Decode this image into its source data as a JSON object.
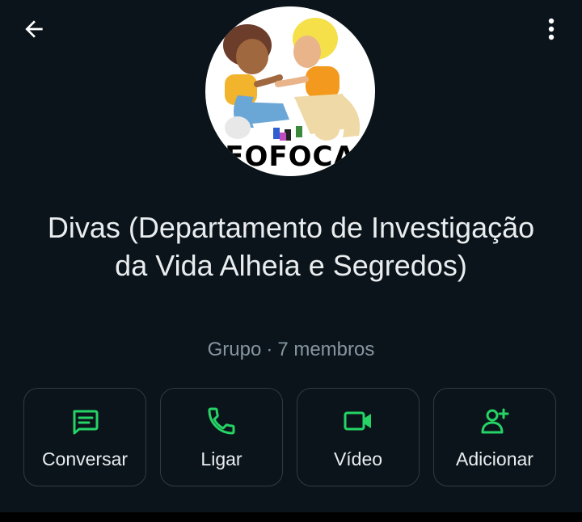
{
  "header": {
    "back_icon": "arrow-left-icon",
    "menu_icon": "more-vert-icon"
  },
  "avatar": {
    "caption": "EOFOCA"
  },
  "group": {
    "name": "Divas (Departamento de Investigação da Vida Alheia e Segredos)",
    "type": "Grupo",
    "separator": "·",
    "members": "7 membros"
  },
  "actions": [
    {
      "label": "Conversar",
      "icon": "message-icon"
    },
    {
      "label": "Ligar",
      "icon": "phone-icon"
    },
    {
      "label": "Vídeo",
      "icon": "video-icon"
    },
    {
      "label": "Adicionar",
      "icon": "add-person-icon"
    }
  ],
  "colors": {
    "background": "#0b141a",
    "accent": "#25d366",
    "text": "#e9edef",
    "muted": "#8696a0",
    "border": "#2f3b43"
  }
}
